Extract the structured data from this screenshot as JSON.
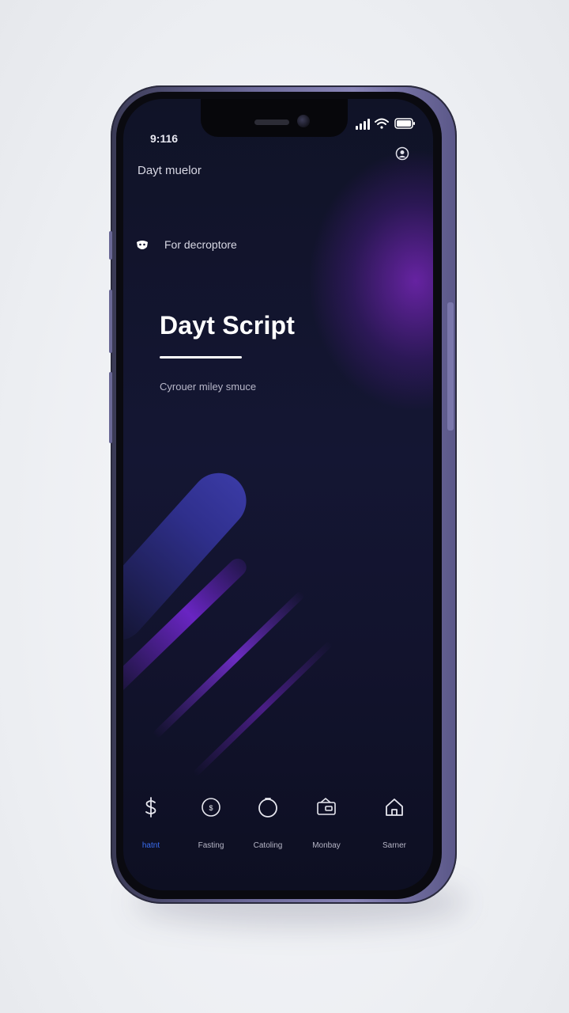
{
  "status_bar": {
    "time": "9:116",
    "icons": [
      "cellular-signal-icon",
      "wifi-icon",
      "battery-icon"
    ]
  },
  "header": {
    "app_title": "Dayt muelor",
    "profile_icon": "profile-icon"
  },
  "section": {
    "icon": "mask-icon",
    "label": "For decroptore"
  },
  "hero": {
    "title": "Dayt Script",
    "subtitle": "Cyrouer miley smuce"
  },
  "tab_bar": {
    "tabs": [
      {
        "label": "hatnt",
        "icon": "dollar-icon",
        "active": true
      },
      {
        "label": "Fasting",
        "icon": "coin-icon",
        "active": false
      },
      {
        "label": "Catoling",
        "icon": "circle-icon",
        "active": false
      },
      {
        "label": "Monbay",
        "icon": "wallet-icon",
        "active": false
      },
      {
        "label": "Sarner",
        "icon": "home-icon",
        "active": false
      }
    ]
  },
  "colors": {
    "screen_background": "#12132d",
    "accent_glow": "#8228c8",
    "active_tab": "#3a6df0",
    "device_frame": "#6d6a9a"
  }
}
